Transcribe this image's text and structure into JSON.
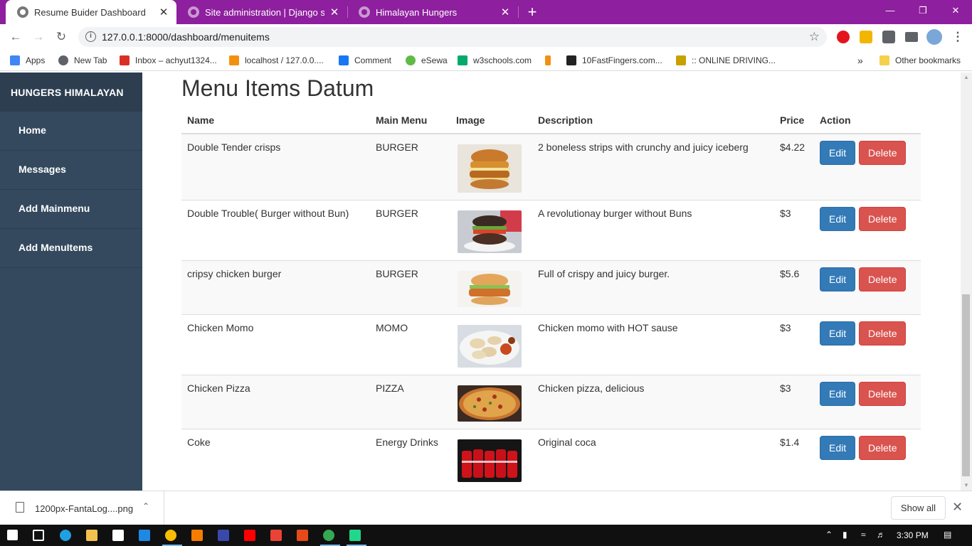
{
  "browser": {
    "tabs": [
      {
        "title": "Resume Buider Dashboard",
        "active": true
      },
      {
        "title": "Site administration | Django site admin",
        "active": false
      },
      {
        "title": "Himalayan Hungers",
        "active": false
      }
    ],
    "new_tab_symbol": "+",
    "close_symbol": "✕",
    "window_controls": {
      "minimize": "—",
      "restore": "❐",
      "close": "✕"
    },
    "url": "127.0.0.1:8000/dashboard/menuitems",
    "bookmarks": [
      {
        "label": "Apps",
        "icon": "apps-grid-icon",
        "color": "#4285f4"
      },
      {
        "label": "New Tab",
        "icon": "globe-icon",
        "color": "#5f6368"
      },
      {
        "label": "Inbox – achyut1324...",
        "icon": "gmail-icon",
        "color": "#d93025"
      },
      {
        "label": "localhost / 127.0.0....",
        "icon": "phpmyadmin-icon",
        "color": "#f29111"
      },
      {
        "label": "Comment",
        "icon": "facebook-icon",
        "color": "#1877f2"
      },
      {
        "label": "eSewa",
        "icon": "esewa-icon",
        "color": "#60bb46"
      },
      {
        "label": "w3schools.com",
        "icon": "w3schools-icon",
        "color": "#04aa6d"
      },
      {
        "label": "",
        "icon": "d-icon",
        "color": "#f29111"
      },
      {
        "label": "10FastFingers.com...",
        "icon": "10fastfingers-icon",
        "color": "#222222"
      },
      {
        "label": ":: ONLINE DRIVING...",
        "icon": "driving-icon",
        "color": "#c8a000"
      }
    ],
    "bookmarks_overflow": "»",
    "other_bookmarks": "Other bookmarks"
  },
  "sidebar": {
    "brand": "HUNGERS HIMALAYAN",
    "items": [
      {
        "label": "Home"
      },
      {
        "label": "Messages"
      },
      {
        "label": "Add Mainmenu"
      },
      {
        "label": "Add MenuItems"
      }
    ]
  },
  "main": {
    "title": "Menu Items Datum",
    "columns": [
      "Name",
      "Main Menu",
      "Image",
      "Description",
      "Price",
      "Action"
    ],
    "edit_label": "Edit",
    "delete_label": "Delete",
    "rows": [
      {
        "name": "Double Tender crisps",
        "main_menu": "BURGER",
        "image": "double-tender-crisps-burger",
        "description": "2 boneless strips with crunchy and juicy iceberg",
        "price": "$4.22"
      },
      {
        "name": "Double Trouble( Burger without Bun)",
        "main_menu": "BURGER",
        "image": "bunless-burger",
        "description": "A revolutionay burger without Buns",
        "price": "$3"
      },
      {
        "name": "cripsy chicken burger",
        "main_menu": "BURGER",
        "image": "crispy-chicken-burger",
        "description": "Full of crispy and juicy burger.",
        "price": "$5.6"
      },
      {
        "name": "Chicken Momo",
        "main_menu": "MOMO",
        "image": "chicken-momo-plate",
        "description": "Chicken momo with HOT sause",
        "price": "$3"
      },
      {
        "name": "Chicken Pizza",
        "main_menu": "PIZZA",
        "image": "chicken-pizza",
        "description": "Chicken pizza, delicious",
        "price": "$3"
      },
      {
        "name": "Coke",
        "main_menu": "Energy Drinks",
        "image": "coke-cans",
        "description": "Original coca",
        "price": "$1.4"
      }
    ]
  },
  "downloads": {
    "file_name": "1200px-FantaLog....png",
    "show_all": "Show all"
  },
  "taskbar": {
    "time": "3:30 PM"
  }
}
